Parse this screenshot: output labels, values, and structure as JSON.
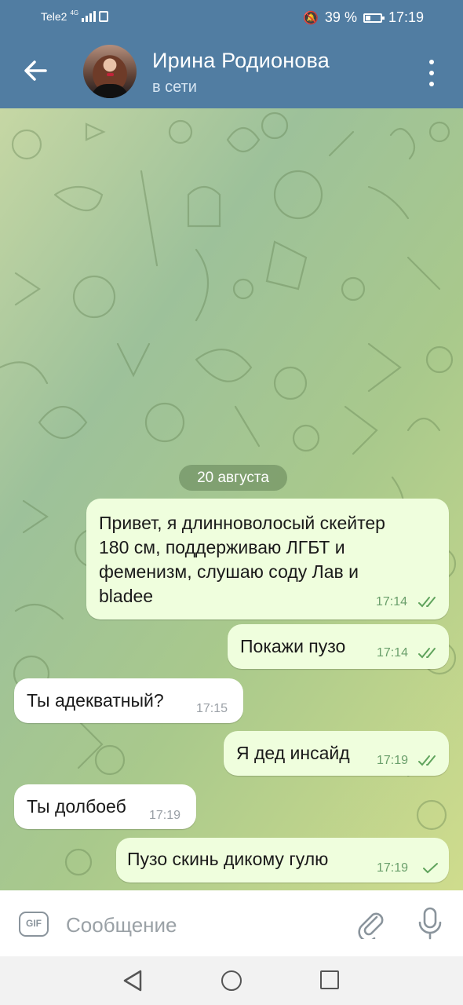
{
  "status_bar": {
    "carrier": "Tele2",
    "network": "4G",
    "battery": "39 %",
    "time": "17:19"
  },
  "header": {
    "back_icon": "arrow-left-icon",
    "contact_name": "Ирина Родионова",
    "status": "в сети",
    "menu_icon": "more-vertical-icon"
  },
  "chat": {
    "date_label": "20 августа",
    "messages": [
      {
        "direction": "out",
        "text": "Привет, я длинноволосый скейтер\n180 см, поддерживаю ЛГБТ и\nфеменизм, слушаю соду Лав и\nbladee",
        "time": "17:14",
        "status": "read"
      },
      {
        "direction": "out",
        "text": "Покажи пузо",
        "time": "17:14",
        "status": "read"
      },
      {
        "direction": "in",
        "text": "Ты адекватный?",
        "time": "17:15"
      },
      {
        "direction": "out",
        "text": "Я дед инсайд",
        "time": "17:19",
        "status": "read"
      },
      {
        "direction": "in",
        "text": "Ты долбоеб",
        "time": "17:19"
      },
      {
        "direction": "out",
        "text": "Пузо скинь дикому гулю",
        "time": "17:19",
        "status": "sent"
      }
    ]
  },
  "input_bar": {
    "gif_label": "GIF",
    "placeholder": "Сообщение",
    "attach_icon": "paperclip-icon",
    "mic_icon": "microphone-icon"
  },
  "colors": {
    "header": "#517da2",
    "outgoing_bubble": "#effedd",
    "incoming_bubble": "#ffffff",
    "check": "#5fa35c"
  }
}
